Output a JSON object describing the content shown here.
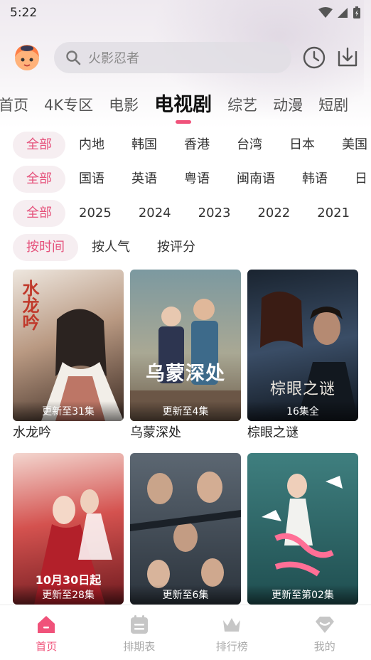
{
  "status_bar": {
    "time": "5:22"
  },
  "search": {
    "placeholder": "火影忍者"
  },
  "tabs": [
    {
      "label": "首页",
      "active": false
    },
    {
      "label": "4K专区",
      "active": false
    },
    {
      "label": "电影",
      "active": false
    },
    {
      "label": "电视剧",
      "active": true
    },
    {
      "label": "综艺",
      "active": false
    },
    {
      "label": "动漫",
      "active": false
    },
    {
      "label": "短剧",
      "active": false
    }
  ],
  "filters": {
    "region": [
      "全部",
      "内地",
      "韩国",
      "香港",
      "台湾",
      "日本",
      "美国"
    ],
    "language": [
      "全部",
      "国语",
      "英语",
      "粤语",
      "闽南语",
      "韩语",
      "日"
    ],
    "year": [
      "全部",
      "2025",
      "2024",
      "2023",
      "2022",
      "2021"
    ],
    "sort": [
      "按时间",
      "按人气",
      "按评分"
    ]
  },
  "cards": [
    {
      "title": "水龙吟",
      "badge": "更新至31集",
      "poster_text": "水龙吟",
      "colors": [
        "#e9e2da",
        "#8c6a55",
        "#4a3528"
      ]
    },
    {
      "title": "乌蒙深处",
      "badge": "更新至4集",
      "poster_text": "乌蒙深处",
      "colors": [
        "#6c8a93",
        "#b9a886",
        "#5a4a3c"
      ]
    },
    {
      "title": "棕眼之谜",
      "badge": "16集全",
      "poster_text": "棕眼之谜",
      "colors": [
        "#2a3a4a",
        "#40506a",
        "#101820"
      ]
    },
    {
      "title": "",
      "badge": "更新至28集",
      "poster_text": "10月30日起",
      "colors": [
        "#c3423f",
        "#e7b2a8",
        "#7a1e22"
      ]
    },
    {
      "title": "",
      "badge": "更新至6集",
      "poster_text": "",
      "colors": [
        "#4f5a66",
        "#b9a48e",
        "#1e252d"
      ]
    },
    {
      "title": "",
      "badge": "更新至第02集",
      "poster_text": "",
      "colors": [
        "#2c6a6a",
        "#e06b8d",
        "#173c3e"
      ]
    }
  ],
  "bottom_nav": [
    {
      "label": "首页",
      "icon": "home-icon",
      "active": true
    },
    {
      "label": "排期表",
      "icon": "calendar-icon",
      "active": false
    },
    {
      "label": "排行榜",
      "icon": "crown-icon",
      "active": false
    },
    {
      "label": "我的",
      "icon": "profile-icon",
      "active": false
    }
  ],
  "colors": {
    "accent": "#f0527a",
    "chip_bg": "#f6eef1"
  }
}
